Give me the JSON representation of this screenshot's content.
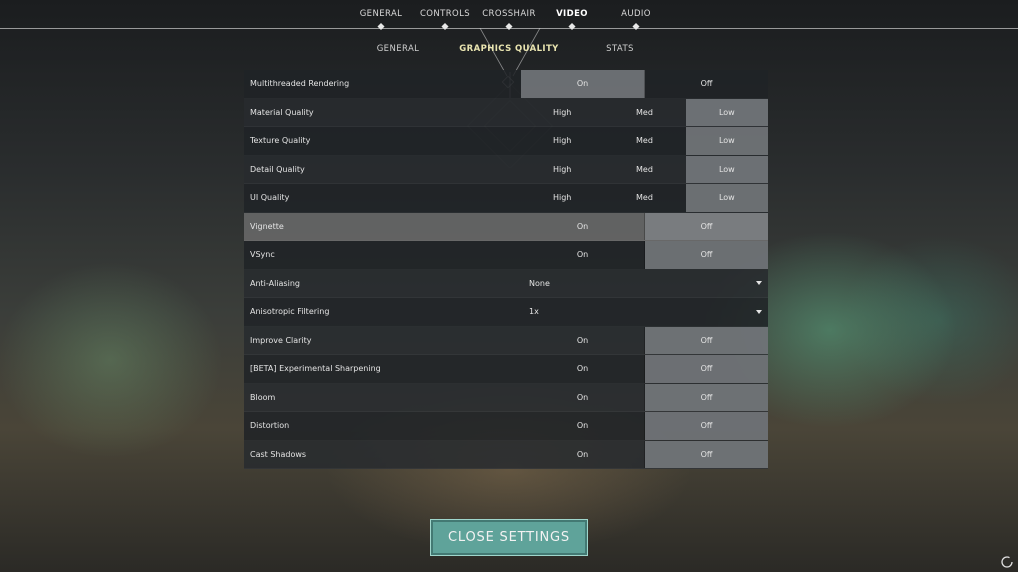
{
  "top_tabs": [
    {
      "label": "GENERAL"
    },
    {
      "label": "CONTROLS"
    },
    {
      "label": "CROSSHAIR"
    },
    {
      "label": "VIDEO",
      "active": true
    },
    {
      "label": "AUDIO"
    }
  ],
  "sub_tabs": [
    {
      "label": "GENERAL"
    },
    {
      "label": "GRAPHICS QUALITY",
      "active": true
    },
    {
      "label": "STATS"
    }
  ],
  "settings": [
    {
      "label": "Multithreaded Rendering",
      "options": [
        "On",
        "Off"
      ],
      "selected": 0
    },
    {
      "label": "Material Quality",
      "options": [
        "High",
        "Med",
        "Low"
      ],
      "selected": 2
    },
    {
      "label": "Texture Quality",
      "options": [
        "High",
        "Med",
        "Low"
      ],
      "selected": 2
    },
    {
      "label": "Detail Quality",
      "options": [
        "High",
        "Med",
        "Low"
      ],
      "selected": 2
    },
    {
      "label": "UI Quality",
      "options": [
        "High",
        "Med",
        "Low"
      ],
      "selected": 2
    },
    {
      "label": "Vignette",
      "options": [
        "On",
        "Off"
      ],
      "selected": 1
    },
    {
      "label": "VSync",
      "options": [
        "On",
        "Off"
      ],
      "selected": 1
    },
    {
      "label": "Anti-Aliasing",
      "dropdown": "None"
    },
    {
      "label": "Anisotropic Filtering",
      "dropdown": "1x"
    },
    {
      "label": "Improve Clarity",
      "options": [
        "On",
        "Off"
      ],
      "selected": 1
    },
    {
      "label": "[BETA] Experimental Sharpening",
      "options": [
        "On",
        "Off"
      ],
      "selected": 1
    },
    {
      "label": "Bloom",
      "options": [
        "On",
        "Off"
      ],
      "selected": 1
    },
    {
      "label": "Distortion",
      "options": [
        "On",
        "Off"
      ],
      "selected": 1
    },
    {
      "label": "Cast Shadows",
      "options": [
        "On",
        "Off"
      ],
      "selected": 1
    }
  ],
  "close_button": {
    "label": "CLOSE SETTINGS"
  },
  "colors": {
    "accent": "#5fa39a",
    "active_subtab": "#e9e4b0"
  },
  "icons": {
    "corner": "loading-ring-icon"
  }
}
